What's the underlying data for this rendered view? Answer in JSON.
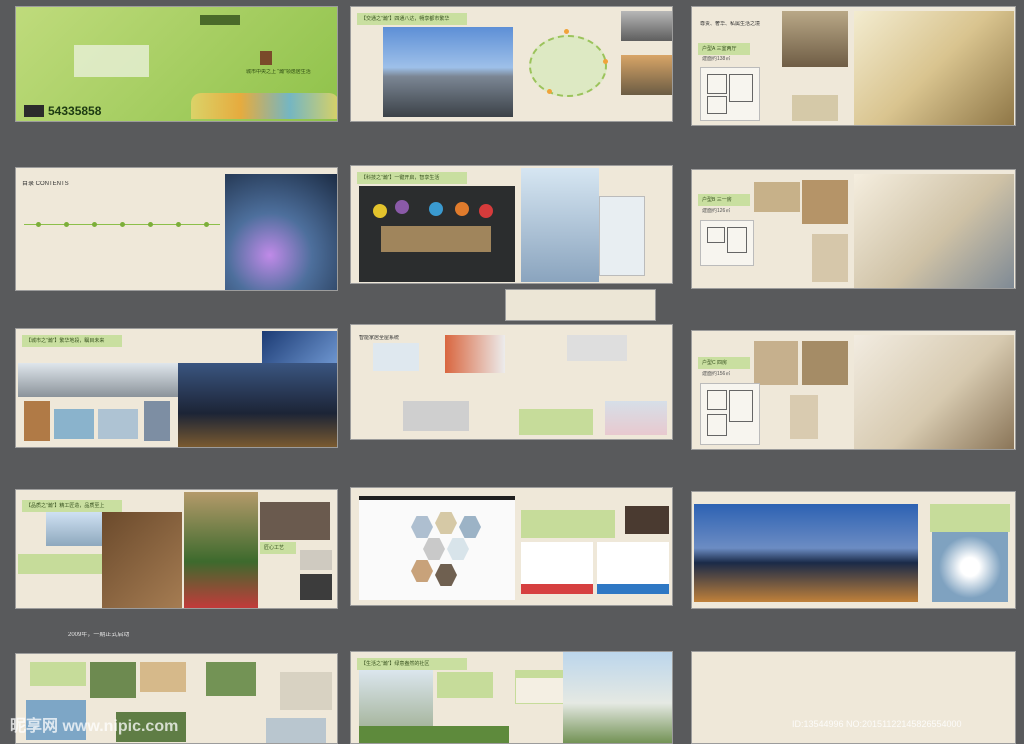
{
  "cover": {
    "phone": "54335858",
    "slogan": "城市中央之上 “瀚”领逸居生活"
  },
  "transit": {
    "title": "【交通之“瀚”】四通八达，畅享都市繁华"
  },
  "unitA": {
    "header": "尊贵、奢华、私属生活之境",
    "label": "户型A 三室两厅",
    "area": "建面约138㎡"
  },
  "contents": {
    "title": "目录 CONTENTS"
  },
  "tech": {
    "title": "【科技之“瀚”】一键开启，智享生活"
  },
  "unitB": {
    "label": "户型B 三一房",
    "area": "建面约126㎡"
  },
  "city": {
    "title": "【城市之“瀚”】繁华地段，瞩目未来"
  },
  "smarthome": {
    "title": "智能家居全屋系统"
  },
  "unitC": {
    "label": "户型C 四房",
    "area": "建面约156㎡"
  },
  "quality": {
    "title": "【品质之“瀚”】精工匠造，品质至上",
    "label": "匠心工艺"
  },
  "year_note": "2009年，一期正式启动",
  "life": {
    "title": "【生活之“瀚”】绿意盎然的社区"
  },
  "watermark": {
    "site": "昵享网 www.nipic.com",
    "id": "ID:13544996 NO:20151122145826554000"
  },
  "colors": {
    "accent": "#c6dc9a",
    "paper": "#efe8d9",
    "bg": "#595a5c"
  }
}
